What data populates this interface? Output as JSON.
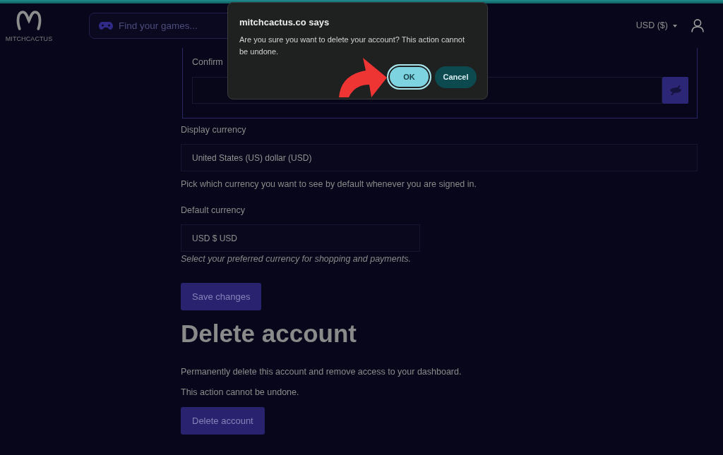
{
  "header": {
    "logo_text": "MITCHCACTUS",
    "search": {
      "placeholder": "Find your games..."
    },
    "currency_menu": "USD ($)"
  },
  "password_panel": {
    "label": "Confirm"
  },
  "display_currency": {
    "label": "Display currency",
    "value": "United States (US) dollar (USD)",
    "help": "Pick which currency you want to see by default whenever you are signed in."
  },
  "default_currency": {
    "label": "Default currency",
    "value": "USD $ USD",
    "help": "Select your preferred currency for shopping and payments."
  },
  "save_button": "Save changes",
  "delete_section": {
    "heading": "Delete account",
    "paragraphs": [
      "Permanently delete this account and remove access to your dashboard.",
      "This action cannot be undone."
    ],
    "button": "Delete account"
  },
  "dialog": {
    "title": "mitchcactus.co says",
    "message": "Are you sure you want to delete your account? This action cannot be undone.",
    "buttons": [
      {
        "label": "OK",
        "focused": true
      },
      {
        "label": "Cancel",
        "focused": false
      }
    ]
  }
}
